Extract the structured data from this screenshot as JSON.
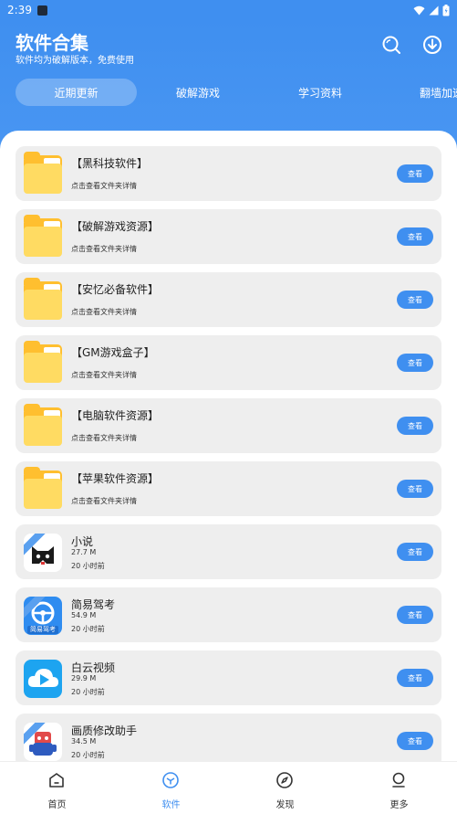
{
  "status": {
    "time": "2:39"
  },
  "header": {
    "title": "软件合集",
    "subtitle": "软件均为破解版本，免费使用",
    "search_icon": "search-icon",
    "download_icon": "download-icon"
  },
  "tabs": [
    {
      "label": "近期更新"
    },
    {
      "label": "破解游戏"
    },
    {
      "label": "学习资料"
    },
    {
      "label": "翻墙加速"
    }
  ],
  "folders": [
    {
      "title": "【黑科技软件】",
      "desc": "点击查看文件夹详情",
      "button": "查看"
    },
    {
      "title": "【破解游戏资源】",
      "desc": "点击查看文件夹详情",
      "button": "查看"
    },
    {
      "title": "【安忆必备软件】",
      "desc": "点击查看文件夹详情",
      "button": "查看"
    },
    {
      "title": "【GM游戏盒子】",
      "desc": "点击查看文件夹详情",
      "button": "查看"
    },
    {
      "title": "【电脑软件资源】",
      "desc": "点击查看文件夹详情",
      "button": "查看"
    },
    {
      "title": "【苹果软件资源】",
      "desc": "点击查看文件夹详情",
      "button": "查看"
    }
  ],
  "apps": [
    {
      "title": "小说",
      "size": "27.7 M",
      "time": "20 小时前",
      "button": "查看",
      "icon": "cat-face-icon"
    },
    {
      "title": "简易驾考",
      "size": "54.9 M",
      "time": "20 小时前",
      "button": "查看",
      "icon": "steering-wheel-icon",
      "icon_caption": "简易驾考"
    },
    {
      "title": "白云视频",
      "size": "29.9 M",
      "time": "20 小时前",
      "button": "查看",
      "icon": "cloud-play-icon"
    },
    {
      "title": "画质修改助手",
      "size": "34.5 M",
      "time": "20 小时前",
      "button": "查看",
      "icon": "robot-icon"
    }
  ],
  "nav": [
    {
      "label": "首页",
      "icon": "home-icon"
    },
    {
      "label": "软件",
      "icon": "cube-icon"
    },
    {
      "label": "发现",
      "icon": "compass-icon"
    },
    {
      "label": "更多",
      "icon": "user-icon"
    }
  ],
  "colors": {
    "primary": "#3f8ff0",
    "folder": "#ffbf2f",
    "card": "#eeeeee"
  }
}
